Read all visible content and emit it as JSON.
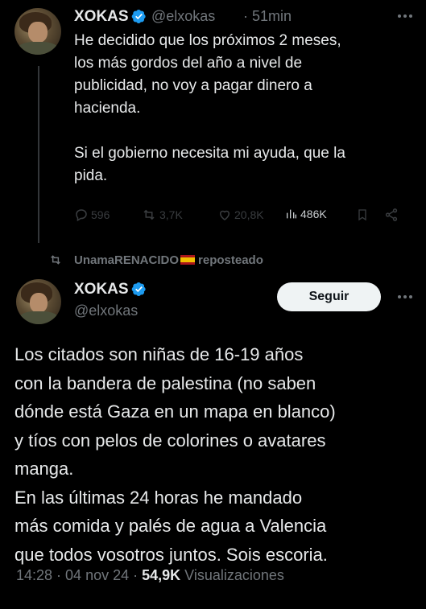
{
  "first_tweet": {
    "author_name": "XOKAS",
    "author_handle": "@elxokas",
    "time": "· 51min",
    "text": "He decidido que los próximos 2 meses,\nlos más gordos del año a nivel de\npublicidad, no voy a pagar dinero a\nhacienda.\n\nSi el gobierno necesita mi ayuda, que la\npida.",
    "actions": {
      "replies": "596",
      "reposts": "3,7K",
      "likes": "20,8K",
      "views": "486K"
    }
  },
  "repost_notice": {
    "user": "UnamaRENACIDO",
    "flag": "spain-flag",
    "label": "reposteado"
  },
  "second_tweet": {
    "author_name": "XOKAS",
    "author_handle": "@elxokas",
    "follow_label": "Seguir",
    "text": "Los citados son niñas de 16-19 años\ncon la bandera de palestina (no saben\ndónde está Gaza en un mapa en blanco)\ny tíos con pelos de colorines o avatares\nmanga.\nEn las últimas 24 horas he mandado\nmás comida y palés de agua a Valencia\nque todos vosotros juntos. Sois escoria.",
    "timestamp": "14:28 · 04 nov 24 · ",
    "views_count": "54,9K",
    "views_label": " Visualizaciones"
  },
  "colors": {
    "background": "#000000",
    "text": "#e7e9ea",
    "secondary": "#71767b",
    "verified": "#1d9bf0"
  }
}
